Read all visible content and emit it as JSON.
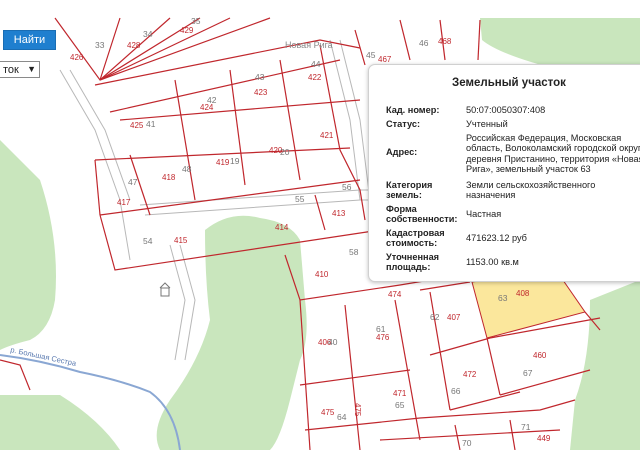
{
  "search_button": {
    "label": "Найти"
  },
  "layer_select": {
    "value": "ток"
  },
  "colors": {
    "plot_line": "#c0272d",
    "forest": "#c9e6bd",
    "road_fill": "#ffffff",
    "selected_plot": "#fbe79c",
    "river": "#8aa7d3",
    "button": "#1f7fcf"
  },
  "map": {
    "street_label": "Новая Рига",
    "river_label": "р. Большая Сестра",
    "cadastral_numbers": [
      "426",
      "428",
      "429",
      "424",
      "425",
      "423",
      "422",
      "421",
      "417",
      "418",
      "419",
      "420",
      "415",
      "414",
      "413",
      "410",
      "406",
      "476",
      "475",
      "475",
      "471",
      "474",
      "407",
      "408",
      "472",
      "460",
      "449",
      "467",
      "468"
    ],
    "plot_numbers": [
      "33",
      "34",
      "35",
      "45",
      "46",
      "43",
      "44",
      "41",
      "42",
      "47",
      "48",
      "19",
      "20",
      "55",
      "56",
      "54",
      "58",
      "61",
      "65",
      "64",
      "62",
      "63",
      "66",
      "67",
      "70",
      "71",
      "40"
    ]
  },
  "popup": {
    "title": "Земельный участок",
    "rows": [
      {
        "key": "Кад. номер:",
        "value": "50:07:0050307:408"
      },
      {
        "key": "Статус:",
        "value": "Учтенный"
      },
      {
        "key": "Адрес:",
        "value": "Российская Федерация, Московская область, Волоколамский городской округ, деревня Пристанино, территория «Новая Рига», земельный участок 63"
      },
      {
        "key": "Категория земель:",
        "value": "Земли сельскохозяйственного назначения"
      },
      {
        "key": "Форма собственности:",
        "value": "Частная"
      },
      {
        "key": "Кадастровая стоимость:",
        "value": "471623.12 руб"
      },
      {
        "key": "Уточненная площадь:",
        "value": "1153.00 кв.м"
      }
    ]
  }
}
